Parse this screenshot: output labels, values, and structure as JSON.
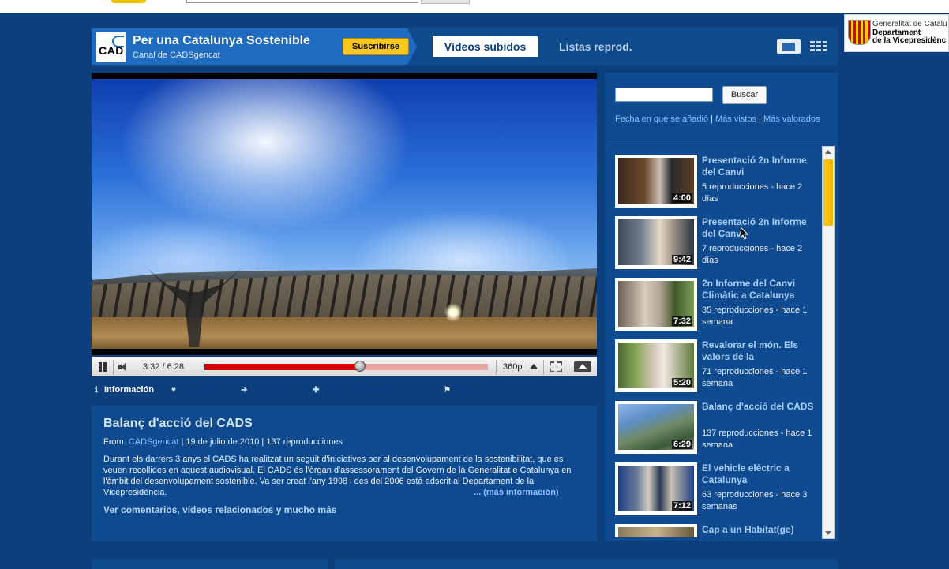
{
  "channel": {
    "logo_text": "CAD",
    "title": "Per una Catalunya Sostenible",
    "subtitle": "Canal de CADSgencat",
    "subscribe_label": "Suscribirse"
  },
  "nav": {
    "tab_uploaded": "Vídeos subidos",
    "tab_playlists": "Listas reprod."
  },
  "gov_logo": {
    "line1": "Generalitat de Catalu",
    "line2": "Departament",
    "line3": "de la Vicepresidènc"
  },
  "player": {
    "time": "3:32 / 6:28",
    "progress_fraction": 0.55,
    "quality": "360p"
  },
  "action_tabs": [
    {
      "label": "Información",
      "icon": "info-icon"
    },
    {
      "label": "Favoritos",
      "icon": "heart-icon"
    },
    {
      "label": "Compartir",
      "icon": "arrow-right-icon"
    },
    {
      "label": "Listas de reproducción",
      "icon": "plus-icon"
    },
    {
      "label": "Marcar",
      "icon": "flag-icon"
    }
  ],
  "video": {
    "title": "Balanç d'acció del CADS",
    "from_label": "From:",
    "channel": "CADSgencat",
    "date": "19 de julio de 2010",
    "views": "137 reproducciones",
    "description": "Durant els darrers 3 anys el CADS ha realitzat un seguit d'iniciatives per al desenvolupament de la sostenibilitat, que es veuen recollides en aquest audiovisual. El CADS és l'òrgan d'assessorament del Govern de la Generalitat e Catalunya en l'àmbit del desenvolupament sostenible. Va ser creat l'any 1998 i des del 2006 està adscrit al Departament de la Vicepresidència.",
    "more_info": "... (más información)",
    "comments_link": "Ver comentarios, vídeos relacionados y mucho más"
  },
  "sidebar": {
    "search_placeholder": "",
    "search_button": "Buscar",
    "sort_date": "Fecha en que se añadió",
    "sort_views": "Más vistos",
    "sort_rated": "Más valorados",
    "items": [
      {
        "title": "Presentació 2n Informe del Canvi",
        "meta": "5 reproducciones - hace 2 días",
        "duration": "4:00"
      },
      {
        "title": "Presentació 2n Informe del Canvi",
        "meta": "7 reproducciones - hace 2 días",
        "duration": "9:42"
      },
      {
        "title": "2n Informe del Canvi Climàtic a Catalunya",
        "meta": "35 reproducciones - hace 1 semana",
        "duration": "7:32"
      },
      {
        "title": "Revalorar el món. Els valors de la",
        "meta": "71 reproducciones - hace 1 semana",
        "duration": "5:20"
      },
      {
        "title": "Balanç d'acció del CADS",
        "meta": "137 reproducciones - hace 1 semana",
        "duration": "6:29"
      },
      {
        "title": "El vehicle elèctric a Catalunya",
        "meta": "63 reproducciones - hace 3 semanas",
        "duration": "7:12"
      },
      {
        "title": "Cap a un Habitat(ge)",
        "meta": "",
        "duration": ""
      }
    ]
  }
}
